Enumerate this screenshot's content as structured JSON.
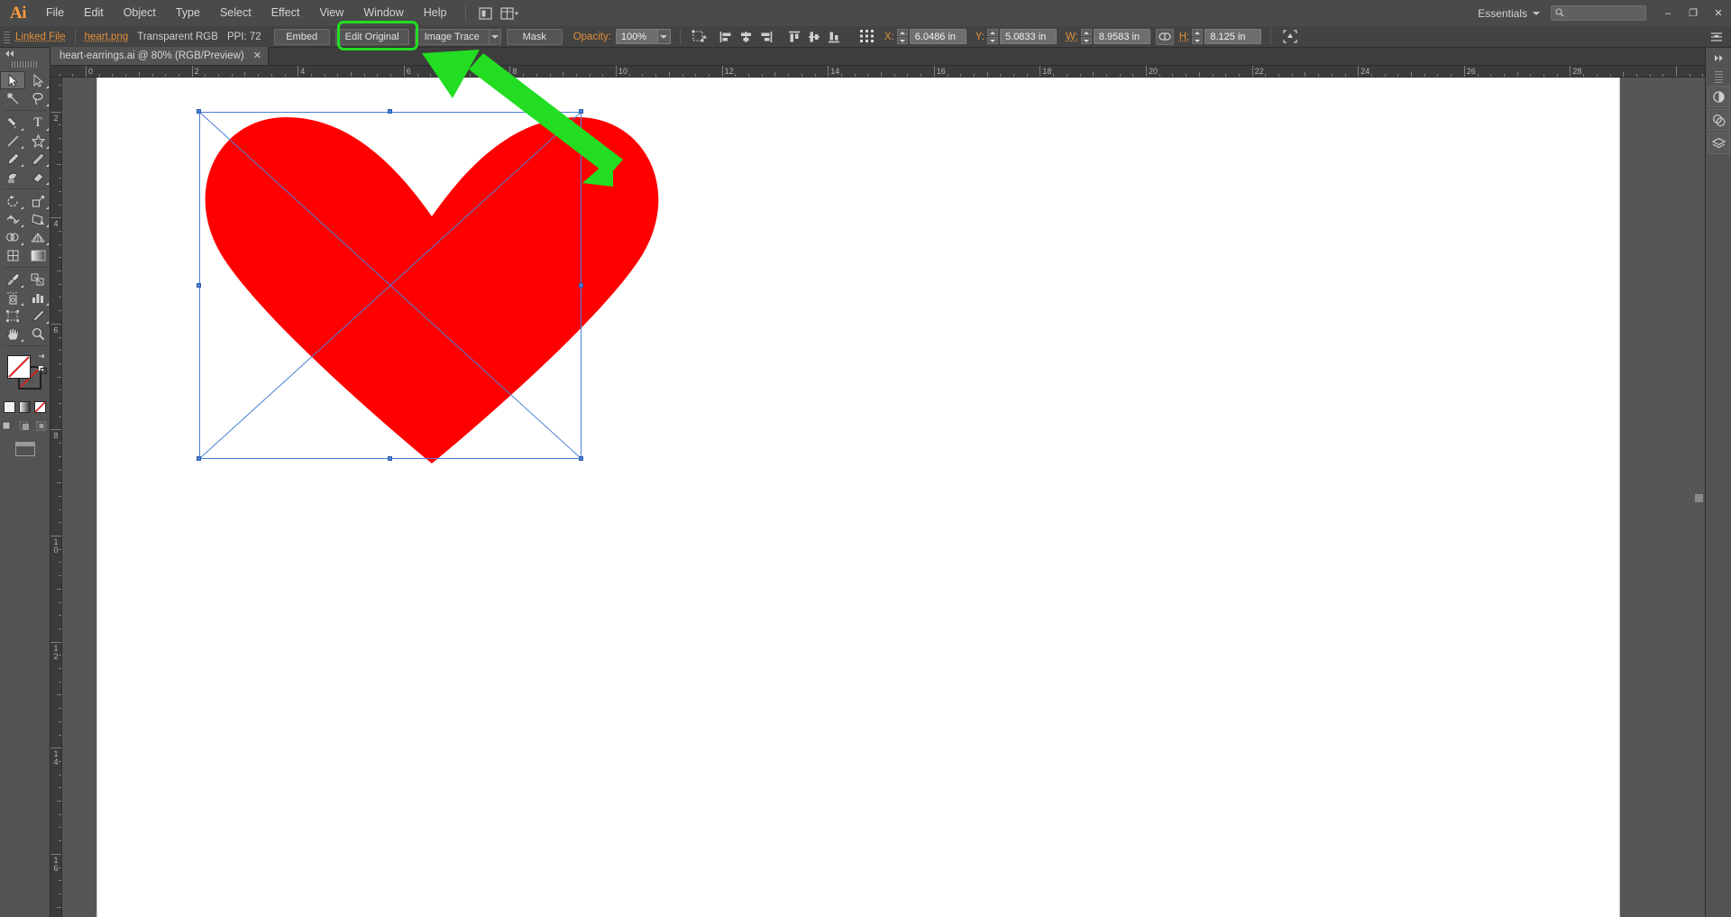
{
  "app": {
    "name": "Adobe Illustrator",
    "logo_text": "Ai",
    "accent_orange": "#e08f3a",
    "highlight_green": "#22dd22",
    "selection_blue": "#4a7ed8",
    "artwork_red": "#ff0000"
  },
  "menubar": {
    "items": [
      {
        "label": "File"
      },
      {
        "label": "Edit"
      },
      {
        "label": "Object"
      },
      {
        "label": "Type"
      },
      {
        "label": "Select"
      },
      {
        "label": "Effect"
      },
      {
        "label": "View"
      },
      {
        "label": "Window"
      },
      {
        "label": "Help"
      }
    ],
    "workspace": {
      "label": "Essentials",
      "icon": "chevron-down-icon"
    },
    "search": {
      "placeholder": "",
      "value": "",
      "icon": "search-icon"
    },
    "window_controls": {
      "minimize": "–",
      "maximize": "❐",
      "close": "✕"
    },
    "bridge_icon": "adobe-bridge-icon",
    "arrange_icon": "arrange-documents-icon"
  },
  "controlbar": {
    "link_status": "Linked File",
    "file_name": "heart.png",
    "color_mode": "Transparent RGB",
    "ppi": "PPI: 72",
    "embed_label": "Embed",
    "edit_original_label": "Edit Original",
    "image_trace_label": "Image Trace",
    "image_trace_highlighted": true,
    "mask_label": "Mask",
    "opacity_label": "Opacity:",
    "opacity_value": "100%",
    "transform_icon": "transform-panel-icon",
    "align_icons": [
      "align-left-icon",
      "align-horizontal-center-icon",
      "align-right-icon",
      "align-top-icon",
      "align-vertical-center-icon",
      "align-bottom-icon"
    ],
    "reference_point_icon": "reference-point-grid-icon",
    "x_label": "X:",
    "x_value": "6.0486 in",
    "y_label": "Y:",
    "y_value": "5.0833 in",
    "w_label": "W:",
    "w_value": "8.9583 in",
    "link_proportions_icon": "chain-link-icon",
    "h_label": "H:",
    "h_value": "8.125 in",
    "isolate_icon": "isolate-selected-icon",
    "overflow_icon": "panel-menu-icon"
  },
  "tabbar": {
    "tabs": [
      {
        "title": "heart-earrings.ai @ 80% (RGB/Preview)",
        "close": "✕",
        "active": true
      }
    ]
  },
  "toolbar": {
    "collapse_icon": "collapse-panel-icon",
    "tools": [
      {
        "name": "selection-tool",
        "glyph": "cursor-arrow-icon",
        "active": true
      },
      {
        "name": "direct-selection-tool",
        "glyph": "direct-select-icon",
        "active": false
      },
      {
        "name": "magic-wand-tool",
        "glyph": "magic-wand-icon",
        "active": false
      },
      {
        "name": "lasso-tool",
        "glyph": "lasso-icon",
        "active": false
      },
      {
        "name": "pen-tool",
        "glyph": "pen-icon",
        "active": false
      },
      {
        "name": "type-tool",
        "glyph": "type-T-icon",
        "active": false
      },
      {
        "name": "line-segment-tool",
        "glyph": "line-icon",
        "active": false
      },
      {
        "name": "shape-tool",
        "glyph": "star-icon",
        "active": false
      },
      {
        "name": "paintbrush-tool",
        "glyph": "paintbrush-icon",
        "active": false
      },
      {
        "name": "pencil-tool",
        "glyph": "pencil-icon",
        "active": false
      },
      {
        "name": "blob-brush-tool",
        "glyph": "blob-brush-icon",
        "active": false
      },
      {
        "name": "eraser-tool",
        "glyph": "eraser-icon",
        "active": false
      },
      {
        "name": "rotate-tool",
        "glyph": "rotate-icon",
        "active": false
      },
      {
        "name": "scale-tool",
        "glyph": "scale-icon",
        "active": false
      },
      {
        "name": "width-tool",
        "glyph": "width-icon",
        "active": false
      },
      {
        "name": "free-transform-tool",
        "glyph": "free-transform-icon",
        "active": false
      },
      {
        "name": "shape-builder-tool",
        "glyph": "shape-builder-icon",
        "active": false
      },
      {
        "name": "perspective-grid-tool",
        "glyph": "perspective-grid-icon",
        "active": false
      },
      {
        "name": "mesh-tool",
        "glyph": "mesh-icon",
        "active": false
      },
      {
        "name": "gradient-tool",
        "glyph": "gradient-icon",
        "active": false
      },
      {
        "name": "eyedropper-tool",
        "glyph": "eyedropper-icon",
        "active": false
      },
      {
        "name": "blend-tool",
        "glyph": "blend-icon",
        "active": false
      },
      {
        "name": "symbol-sprayer-tool",
        "glyph": "symbol-sprayer-icon",
        "active": false
      },
      {
        "name": "column-graph-tool",
        "glyph": "bar-graph-icon",
        "active": false
      },
      {
        "name": "artboard-tool",
        "glyph": "artboard-icon",
        "active": false
      },
      {
        "name": "slice-tool",
        "glyph": "slice-knife-icon",
        "active": false
      },
      {
        "name": "hand-tool",
        "glyph": "hand-icon",
        "active": false
      },
      {
        "name": "zoom-tool",
        "glyph": "magnifier-icon",
        "active": false
      }
    ],
    "fill_color": "#ffffff",
    "stroke_color": "none",
    "swap_icon": "swap-fill-stroke-icon",
    "default_icon": "default-fill-stroke-icon",
    "fill_stroke_modes": [
      "color-swatch-icon",
      "gradient-swatch-icon",
      "none-swatch-icon"
    ],
    "draw_modes": [
      "draw-normal-icon",
      "draw-behind-icon",
      "draw-inside-icon"
    ],
    "screen_mode_icon": "change-screen-mode-icon"
  },
  "rulers": {
    "units": "in",
    "horizontal_labels": [
      "0",
      "2",
      "4",
      "6",
      "8",
      "10",
      "12",
      "14",
      "16",
      "18",
      "20",
      "22",
      "24",
      "26",
      "28"
    ],
    "vertical_labels": [
      "2",
      "4",
      "6",
      "8",
      "10",
      "12",
      "14",
      "16"
    ],
    "zoom": "80%"
  },
  "canvas": {
    "artwork": {
      "name": "heart-shape",
      "color": "#ff0000",
      "selected": true
    },
    "selection": {
      "show_diagonals": true,
      "handles": 8
    }
  },
  "annotation": {
    "arrow": {
      "name": "green-pointer-arrow",
      "color": "#22dd22",
      "points_to": "Image Trace"
    },
    "highlight_box": {
      "name": "image-trace-highlight",
      "color": "#22dd22"
    }
  },
  "right_rail": {
    "buttons": [
      {
        "name": "color-panel-icon"
      },
      {
        "name": "appearance-panel-icon"
      },
      {
        "name": "layers-panel-icon"
      }
    ],
    "label": "",
    "expand_icon": "expand-panels-icon"
  }
}
